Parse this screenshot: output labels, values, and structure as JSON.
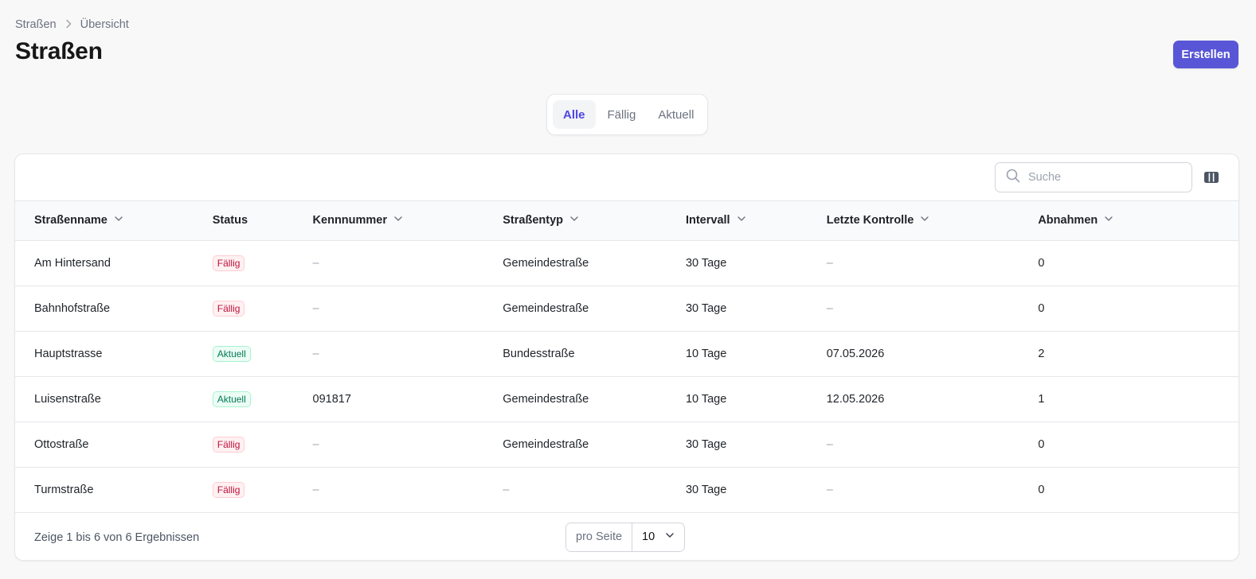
{
  "breadcrumb": {
    "items": [
      "Straßen",
      "Übersicht"
    ]
  },
  "page": {
    "title": "Straßen",
    "create_label": "Erstellen"
  },
  "filter_tabs": [
    {
      "label": "Alle",
      "active": true
    },
    {
      "label": "Fällig",
      "active": false
    },
    {
      "label": "Aktuell",
      "active": false
    }
  ],
  "search": {
    "placeholder": "Suche",
    "value": ""
  },
  "table": {
    "columns": [
      {
        "label": "Straßenname",
        "sortable": true
      },
      {
        "label": "Status",
        "sortable": false
      },
      {
        "label": "Kennnummer",
        "sortable": true
      },
      {
        "label": "Straßentyp",
        "sortable": true
      },
      {
        "label": "Intervall",
        "sortable": true
      },
      {
        "label": "Letzte Kontrolle",
        "sortable": true
      },
      {
        "label": "Abnahmen",
        "sortable": true
      }
    ],
    "rows": [
      {
        "name": "Am Hintersand",
        "status": "Fällig",
        "id": "–",
        "type": "Gemeindestraße",
        "interval": "30 Tage",
        "last_check": "–",
        "acceptances": "0"
      },
      {
        "name": "Bahnhofstraße",
        "status": "Fällig",
        "id": "–",
        "type": "Gemeindestraße",
        "interval": "30 Tage",
        "last_check": "–",
        "acceptances": "0"
      },
      {
        "name": "Hauptstrasse",
        "status": "Aktuell",
        "id": "–",
        "type": "Bundesstraße",
        "interval": "10 Tage",
        "last_check": "07.05.2026",
        "acceptances": "2"
      },
      {
        "name": "Luisenstraße",
        "status": "Aktuell",
        "id": "091817",
        "type": "Gemeindestraße",
        "interval": "10 Tage",
        "last_check": "12.05.2026",
        "acceptances": "1"
      },
      {
        "name": "Ottostraße",
        "status": "Fällig",
        "id": "–",
        "type": "Gemeindestraße",
        "interval": "30 Tage",
        "last_check": "–",
        "acceptances": "0"
      },
      {
        "name": "Turmstraße",
        "status": "Fällig",
        "id": "–",
        "type": "–",
        "interval": "30 Tage",
        "last_check": "–",
        "acceptances": "0"
      }
    ]
  },
  "pagination": {
    "summary": "Zeige 1 bis 6 von 6 Ergebnissen",
    "per_page_label": "pro Seite",
    "per_page_value": "10"
  },
  "colors": {
    "primary": "#5856d6",
    "active_tab": "#4f46e5",
    "faellig": "#be123c",
    "aktuell": "#047857"
  },
  "icons": [
    "chevron-right-icon",
    "search-icon",
    "columns-icon",
    "chevron-down-icon"
  ]
}
